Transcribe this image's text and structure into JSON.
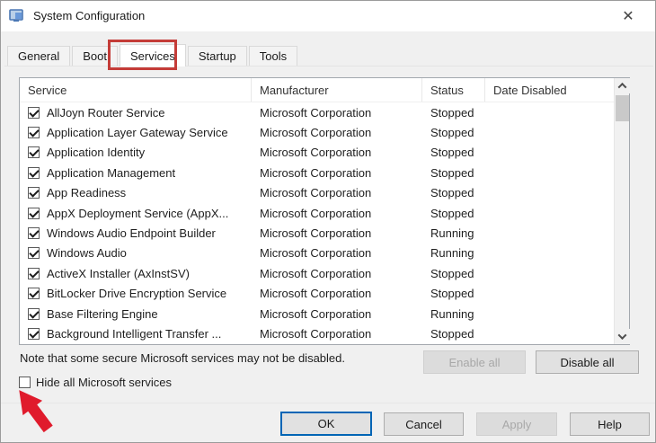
{
  "window": {
    "title": "System Configuration",
    "close_glyph": "✕"
  },
  "tabs": [
    {
      "label": "General",
      "active": false
    },
    {
      "label": "Boot",
      "active": false
    },
    {
      "label": "Services",
      "active": true,
      "annotated": true
    },
    {
      "label": "Startup",
      "active": false
    },
    {
      "label": "Tools",
      "active": false
    }
  ],
  "services_table": {
    "columns": [
      "Service",
      "Manufacturer",
      "Status",
      "Date Disabled"
    ],
    "rows": [
      {
        "checked": true,
        "service": "AllJoyn Router Service",
        "manufacturer": "Microsoft Corporation",
        "status": "Stopped",
        "date_disabled": ""
      },
      {
        "checked": true,
        "service": "Application Layer Gateway Service",
        "manufacturer": "Microsoft Corporation",
        "status": "Stopped",
        "date_disabled": ""
      },
      {
        "checked": true,
        "service": "Application Identity",
        "manufacturer": "Microsoft Corporation",
        "status": "Stopped",
        "date_disabled": ""
      },
      {
        "checked": true,
        "service": "Application Management",
        "manufacturer": "Microsoft Corporation",
        "status": "Stopped",
        "date_disabled": ""
      },
      {
        "checked": true,
        "service": "App Readiness",
        "manufacturer": "Microsoft Corporation",
        "status": "Stopped",
        "date_disabled": ""
      },
      {
        "checked": true,
        "service": "AppX Deployment Service (AppX...",
        "manufacturer": "Microsoft Corporation",
        "status": "Stopped",
        "date_disabled": ""
      },
      {
        "checked": true,
        "service": "Windows Audio Endpoint Builder",
        "manufacturer": "Microsoft Corporation",
        "status": "Running",
        "date_disabled": ""
      },
      {
        "checked": true,
        "service": "Windows Audio",
        "manufacturer": "Microsoft Corporation",
        "status": "Running",
        "date_disabled": ""
      },
      {
        "checked": true,
        "service": "ActiveX Installer (AxInstSV)",
        "manufacturer": "Microsoft Corporation",
        "status": "Stopped",
        "date_disabled": ""
      },
      {
        "checked": true,
        "service": "BitLocker Drive Encryption Service",
        "manufacturer": "Microsoft Corporation",
        "status": "Stopped",
        "date_disabled": ""
      },
      {
        "checked": true,
        "service": "Base Filtering Engine",
        "manufacturer": "Microsoft Corporation",
        "status": "Running",
        "date_disabled": ""
      },
      {
        "checked": true,
        "service": "Background Intelligent Transfer ...",
        "manufacturer": "Microsoft Corporation",
        "status": "Stopped",
        "date_disabled": ""
      }
    ]
  },
  "note": {
    "text": "Note that some secure Microsoft services may not be disabled."
  },
  "hide_checkbox": {
    "label": "Hide all Microsoft services",
    "checked": false
  },
  "buttons": {
    "enable_all": {
      "label": "Enable all",
      "disabled": true
    },
    "disable_all": {
      "label": "Disable all",
      "disabled": false
    },
    "ok": {
      "label": "OK",
      "default": true
    },
    "cancel": {
      "label": "Cancel"
    },
    "apply": {
      "label": "Apply",
      "disabled": true
    },
    "help": {
      "label": "Help"
    }
  },
  "annotations": {
    "tab_highlight_color": "#c43c38",
    "arrow_color": "#e01b2c"
  }
}
